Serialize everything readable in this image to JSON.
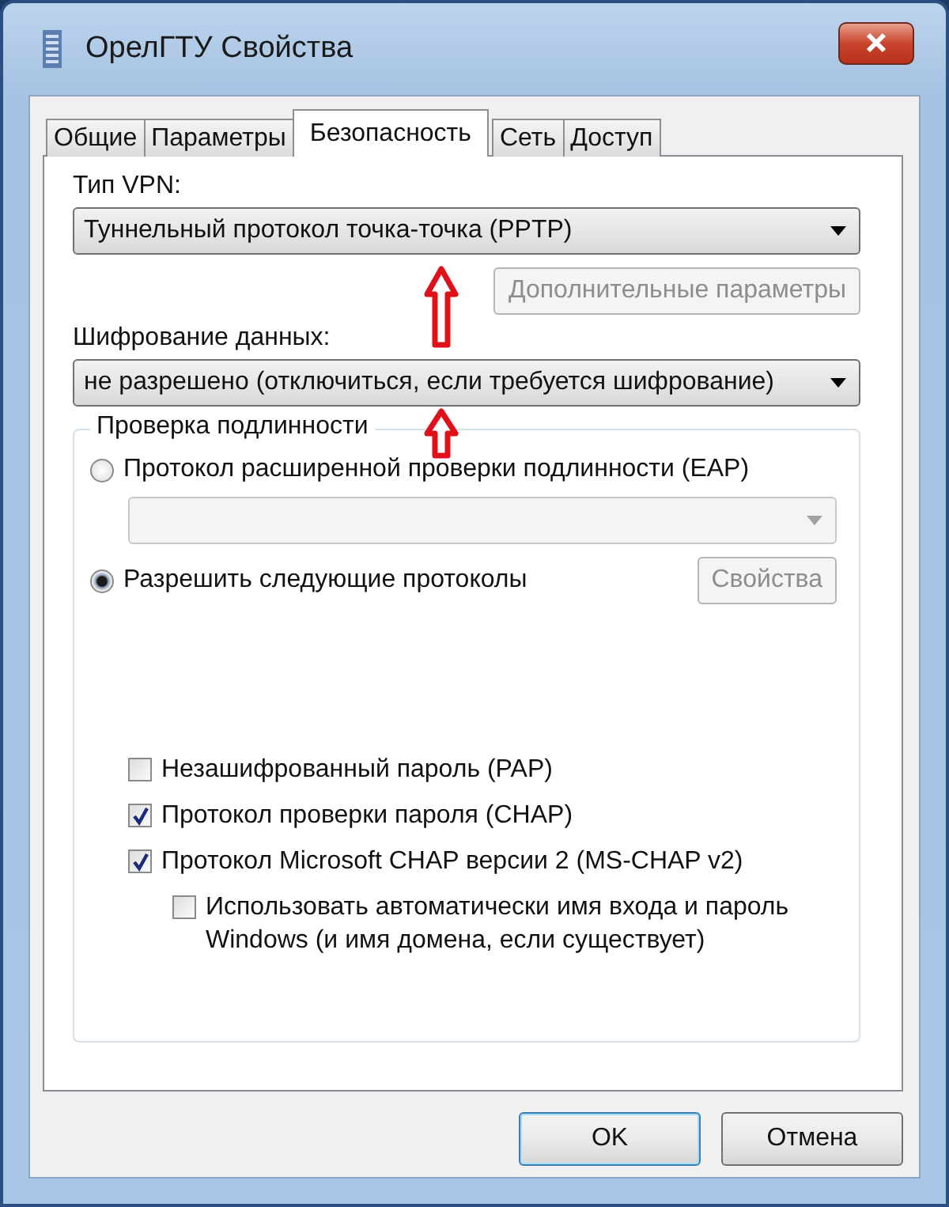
{
  "window": {
    "title": "ОрелГТУ Свойства"
  },
  "tabs": [
    {
      "label": "Общие",
      "selected": false
    },
    {
      "label": "Параметры",
      "selected": false
    },
    {
      "label": "Безопасность",
      "selected": true
    },
    {
      "label": "Сеть",
      "selected": false
    },
    {
      "label": "Доступ",
      "selected": false
    }
  ],
  "vpn_type": {
    "label": "Тип VPN:",
    "value": "Туннельный протокол точка-точка (PPTP)"
  },
  "advanced_button": {
    "label": "Дополнительные параметры",
    "disabled": true
  },
  "encryption": {
    "label": "Шифрование данных:",
    "value": "не разрешено (отключиться, если требуется шифрование)"
  },
  "authentication": {
    "title": "Проверка подлинности",
    "eap": {
      "label": "Протокол расширенной проверки подлинности (EAP)",
      "selected": false
    },
    "eap_method": {
      "disabled": true
    },
    "allow": {
      "label": "Разрешить следующие протоколы",
      "selected": true
    },
    "properties_button": {
      "label": "Свойства",
      "disabled": true
    },
    "protocols": [
      {
        "label": "Незашифрованный пароль (PAP)",
        "checked": false
      },
      {
        "label": "Протокол проверки пароля (CHAP)",
        "checked": true
      },
      {
        "label": "Протокол Microsoft CHAP версии 2 (MS-CHAP v2)",
        "checked": true,
        "children": [
          {
            "label": "Использовать автоматически имя входа и пароль Windows (и имя домена, если существует)",
            "checked": false
          }
        ]
      }
    ]
  },
  "buttons": [
    {
      "label": "OK",
      "default": true
    },
    {
      "label": "Отмена",
      "default": false
    }
  ]
}
